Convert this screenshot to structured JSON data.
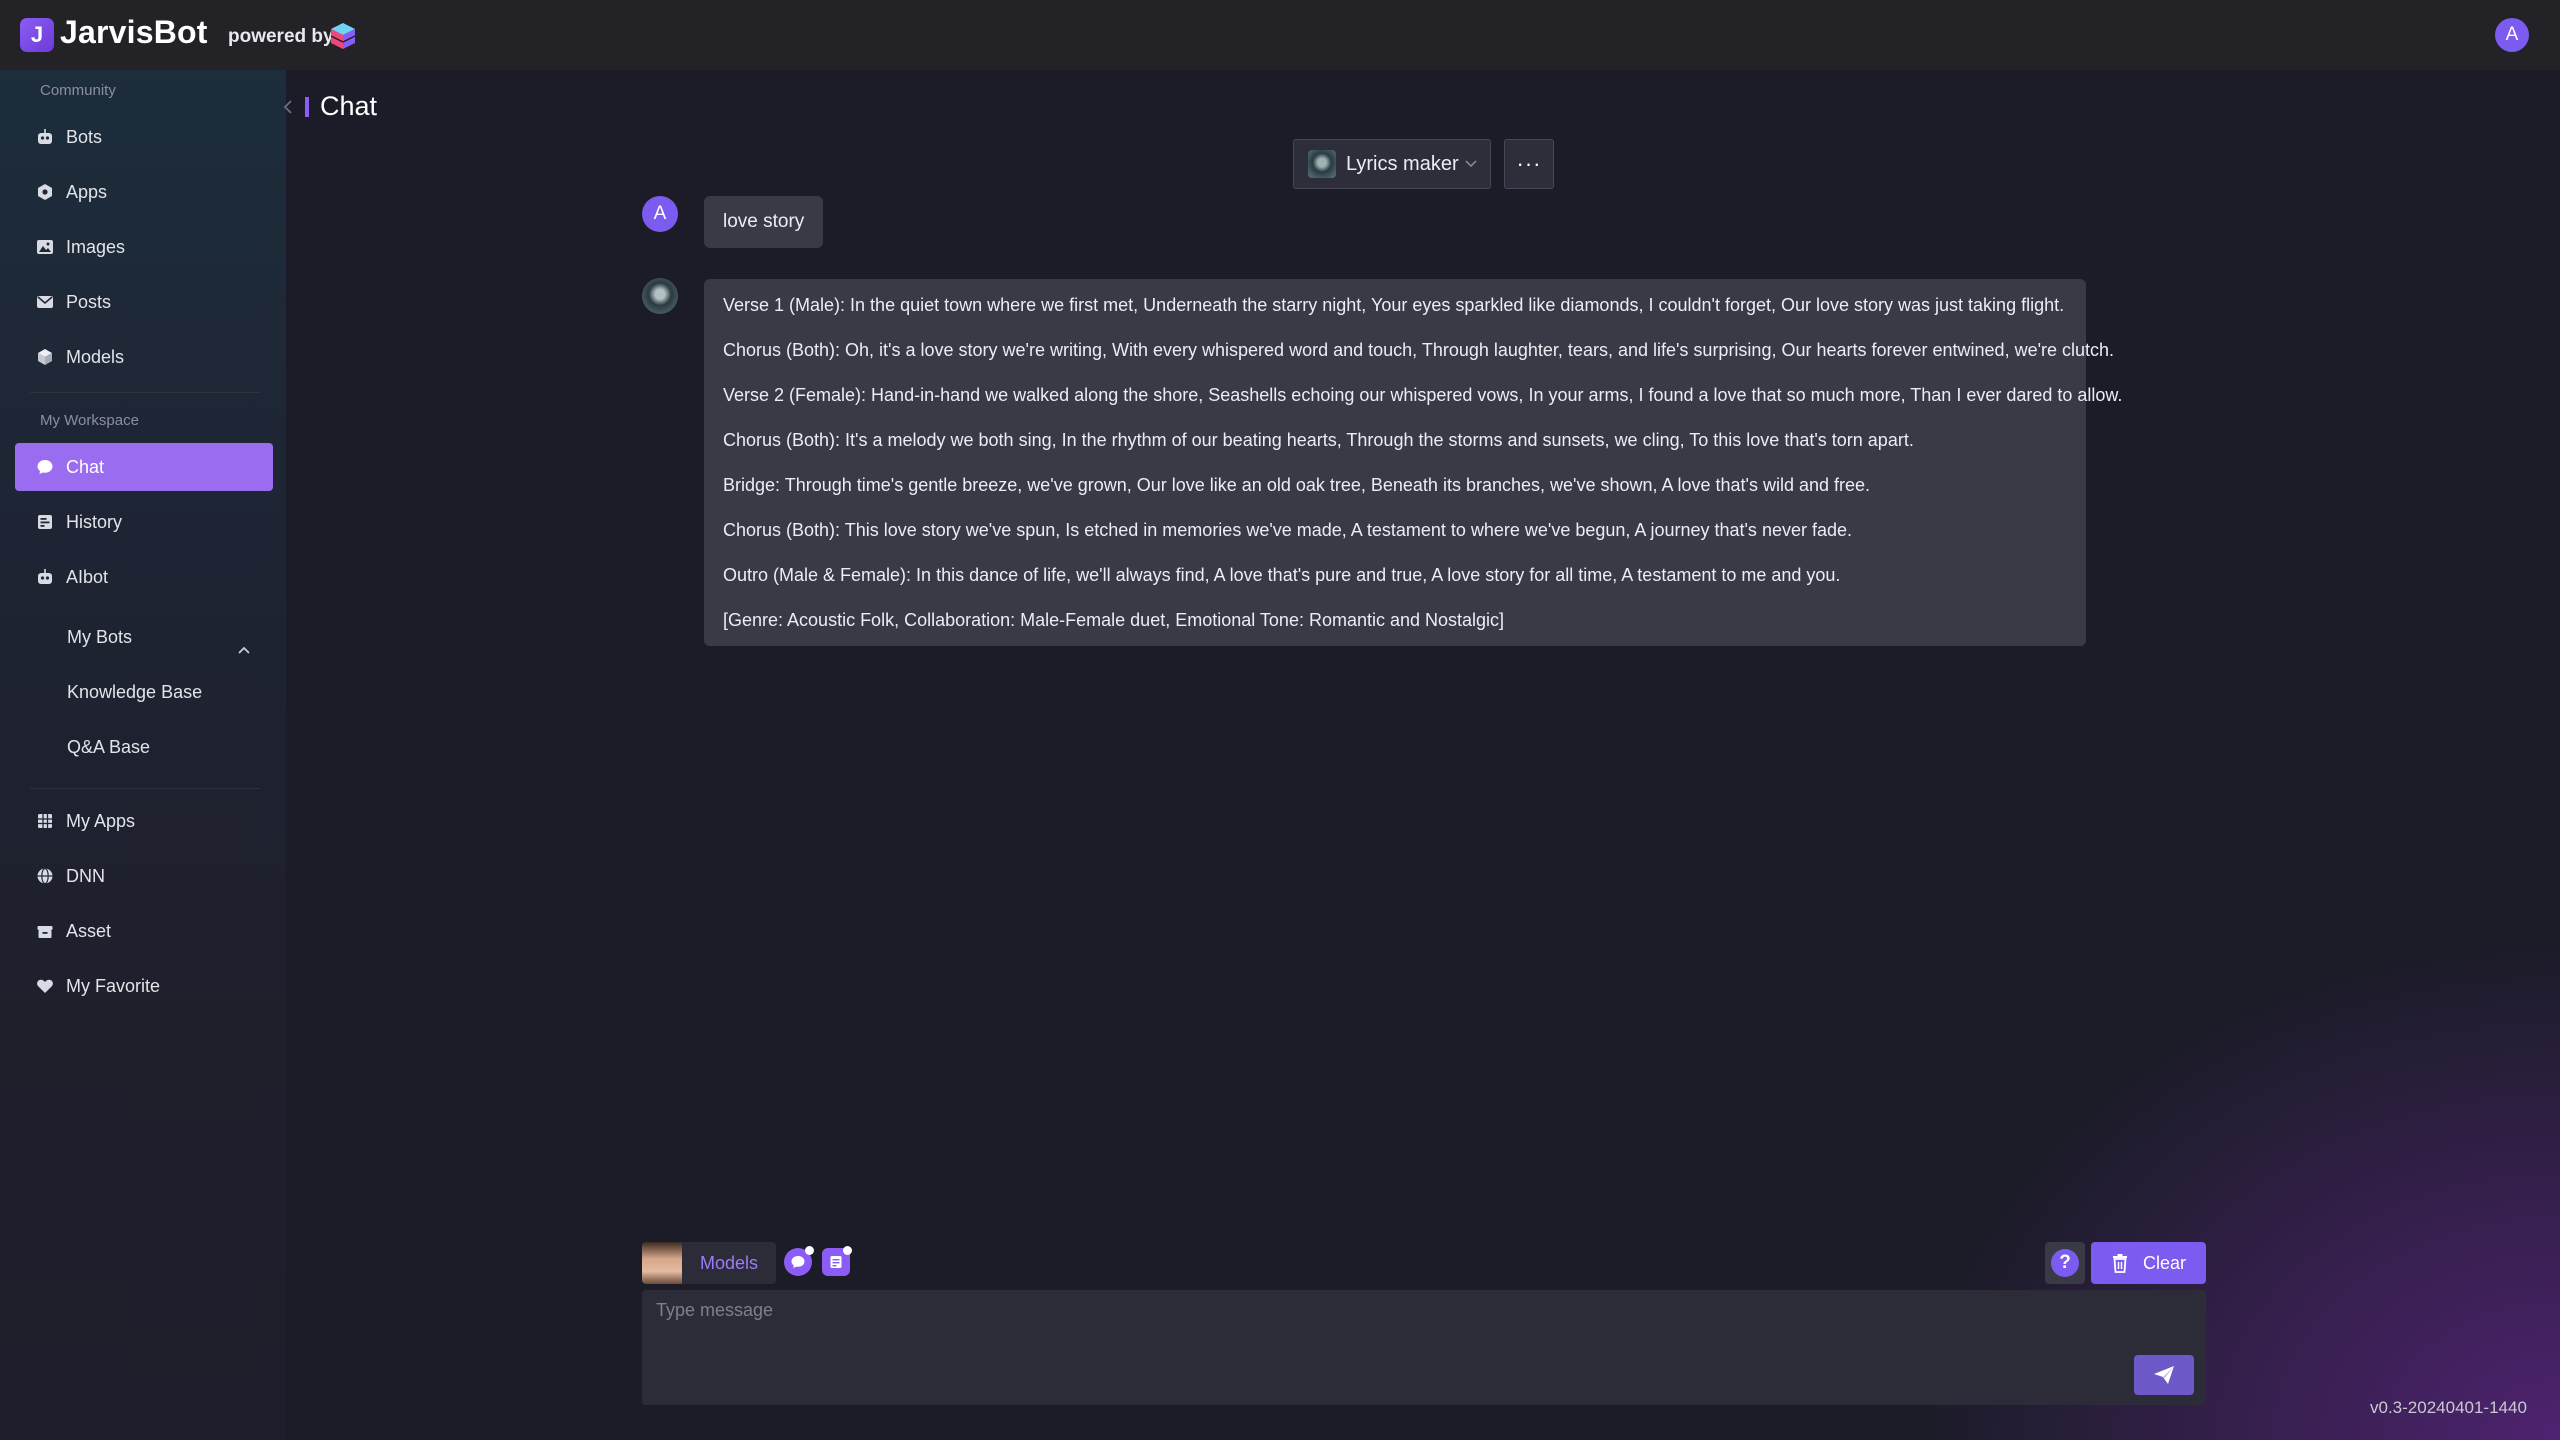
{
  "app": {
    "name": "JarvisBot",
    "powered_by": "powered by",
    "user_initial": "A",
    "version": "v0.3-20240401-1440",
    "accent_color": "#8b5cf6"
  },
  "sidebar": {
    "community_label": "Community",
    "community_items": [
      {
        "label": "Bots",
        "icon": "robot-icon"
      },
      {
        "label": "Apps",
        "icon": "hexagon-icon"
      },
      {
        "label": "Images",
        "icon": "image-icon"
      },
      {
        "label": "Posts",
        "icon": "mail-icon"
      },
      {
        "label": "Models",
        "icon": "cube-icon"
      }
    ],
    "workspace_label": "My Workspace",
    "workspace_items": [
      {
        "label": "Chat",
        "icon": "chat-icon",
        "active": true
      },
      {
        "label": "History",
        "icon": "history-icon"
      },
      {
        "label": "AIbot",
        "icon": "robot-icon"
      }
    ],
    "aibot_sub_items": [
      "My Bots",
      "Knowledge Base",
      "Q&A Base"
    ],
    "other_items": [
      {
        "label": "My Apps",
        "icon": "grid-icon"
      },
      {
        "label": "DNN",
        "icon": "globe-icon"
      },
      {
        "label": "Asset",
        "icon": "box-icon"
      },
      {
        "label": "My Favorite",
        "icon": "heart-icon"
      }
    ]
  },
  "header": {
    "title": "Chat"
  },
  "bot_selector": {
    "selected": "Lyrics maker",
    "more_label": "···"
  },
  "conversation": {
    "user_initial": "A",
    "user_message": "love story",
    "bot_reply": [
      "Verse 1 (Male): In the quiet town where we first met, Underneath the starry night, Your eyes sparkled like diamonds, I couldn't forget, Our love story was just taking flight.",
      "Chorus (Both): Oh, it's a love story we're writing, With every whispered word and touch, Through laughter, tears, and life's surprising, Our hearts forever entwined, we're clutch.",
      "Verse 2 (Female): Hand-in-hand we walked along the shore, Seashells echoing our whispered vows, In your arms, I found a love that so much more, Than I ever dared to allow.",
      "Chorus (Both): It's a melody we both sing, In the rhythm of our beating hearts, Through the storms and sunsets, we cling, To this love that's torn apart.",
      "Bridge: Through time's gentle breeze, we've grown, Our love like an old oak tree, Beneath its branches, we've shown, A love that's wild and free.",
      "Chorus (Both): This love story we've spun, Is etched in memories we've made, A testament to where we've begun, A journey that's never fade.",
      "Outro (Male & Female): In this dance of life, we'll always find, A love that's pure and true, A love story for all time, A testament to me and you.",
      "[Genre: Acoustic Folk, Collaboration: Male-Female duet, Emotional Tone: Romantic and Nostalgic]"
    ]
  },
  "composer": {
    "models_label": "Models",
    "clear_label": "Clear",
    "help_label": "?",
    "placeholder": "Type message",
    "value": ""
  }
}
